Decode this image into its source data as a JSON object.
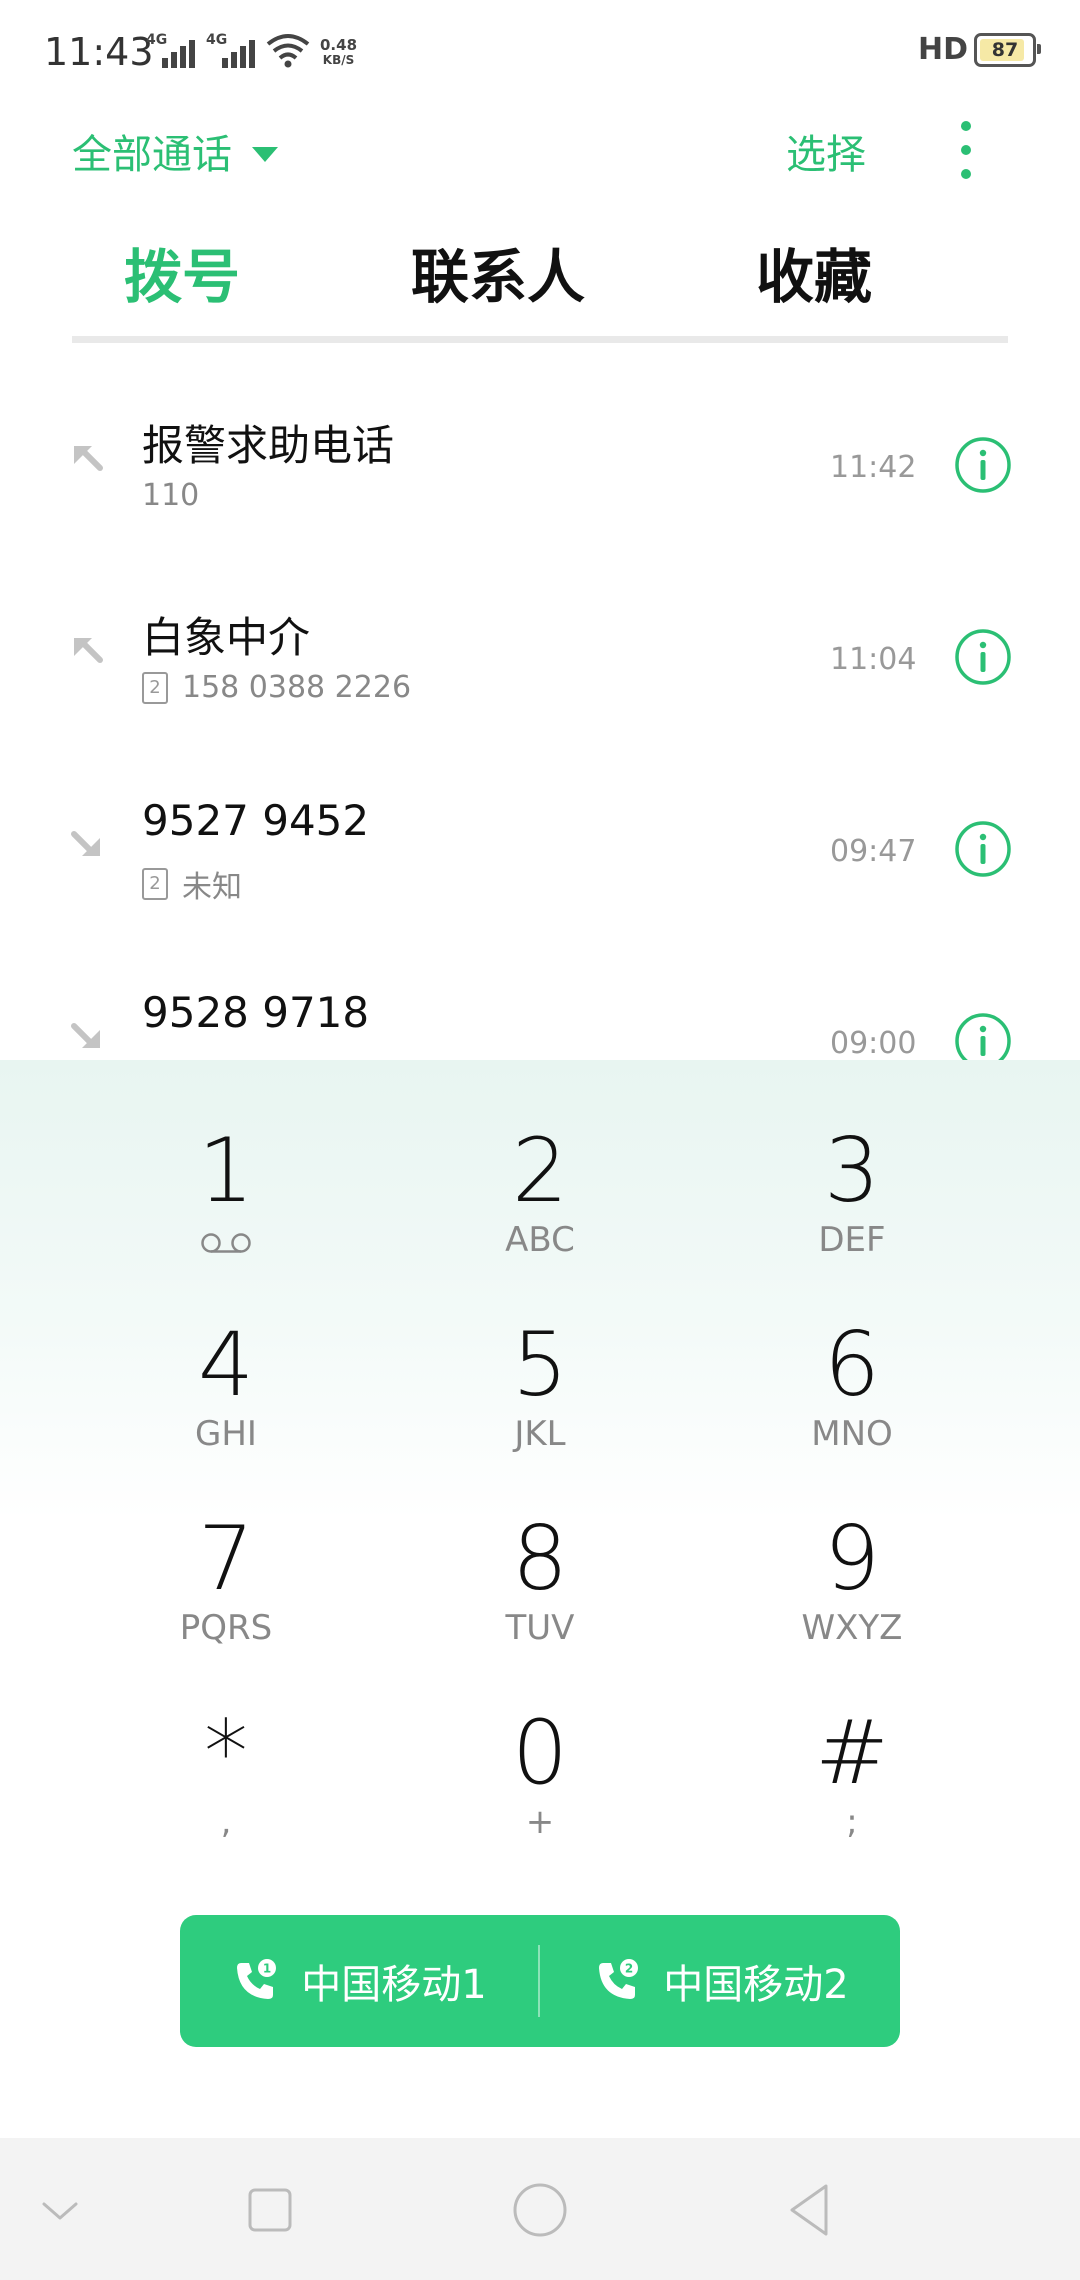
{
  "status_bar": {
    "time": "11:43",
    "signal1": "4G",
    "signal2": "4G",
    "net_speed_value": "0.48",
    "net_speed_unit": "KB/S",
    "hd": "HD",
    "battery": "87"
  },
  "header": {
    "filter_label": "全部通话",
    "select_label": "选择"
  },
  "tabs": [
    {
      "label": "拨号",
      "active": true
    },
    {
      "label": "联系人",
      "active": false
    },
    {
      "label": "收藏",
      "active": false
    }
  ],
  "calls": [
    {
      "name": "报警求助电话",
      "detail": "110",
      "sim": "",
      "time": "11:42",
      "direction": "outgoing"
    },
    {
      "name": "白象中介",
      "detail": "158 0388 2226",
      "sim": "2",
      "time": "11:04",
      "direction": "outgoing"
    },
    {
      "name": "9527 9452",
      "detail": "未知",
      "sim": "2",
      "time": "09:47",
      "direction": "incoming"
    },
    {
      "name": "9528 9718",
      "detail": "",
      "sim": "",
      "time": "09:00",
      "direction": "incoming"
    }
  ],
  "dialpad": [
    {
      "digit": "1",
      "letters": ""
    },
    {
      "digit": "2",
      "letters": "ABC"
    },
    {
      "digit": "3",
      "letters": "DEF"
    },
    {
      "digit": "4",
      "letters": "GHI"
    },
    {
      "digit": "5",
      "letters": "JKL"
    },
    {
      "digit": "6",
      "letters": "MNO"
    },
    {
      "digit": "7",
      "letters": "PQRS"
    },
    {
      "digit": "8",
      "letters": "TUV"
    },
    {
      "digit": "9",
      "letters": "WXYZ"
    },
    {
      "digit": "*",
      "letters": ","
    },
    {
      "digit": "0",
      "letters": "+"
    },
    {
      "digit": "#",
      "letters": ";"
    }
  ],
  "call_buttons": {
    "sim1_label": "中国移动1",
    "sim1_badge": "1",
    "sim2_label": "中国移动2",
    "sim2_badge": "2"
  },
  "colors": {
    "accent": "#2bbf74",
    "call_button": "#2ecc7e",
    "secondary_text": "#888888"
  },
  "icons": {
    "dropdown": "triangle-down-icon",
    "more": "more-vertical-icon",
    "outgoing": "outgoing-call-arrow-icon",
    "incoming": "incoming-call-arrow-icon",
    "info": "info-icon",
    "voicemail": "voicemail-icon",
    "phone": "phone-icon"
  }
}
